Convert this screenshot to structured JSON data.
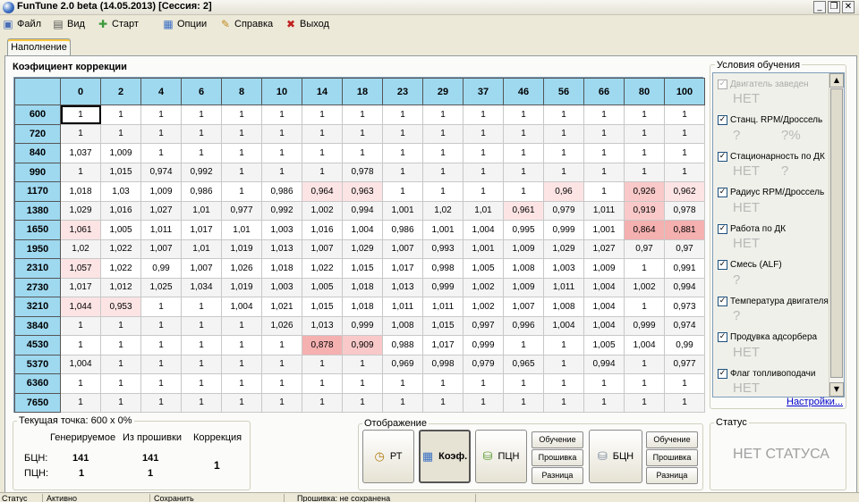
{
  "window": {
    "title": "FunTune 2.0 beta (14.05.2013) [Сессия: 2]",
    "controls": [
      "_",
      "❐",
      "✕"
    ]
  },
  "menu": [
    {
      "label": "Файл",
      "icon": "floppy-disk-icon"
    },
    {
      "label": "Вид",
      "icon": "table-icon"
    },
    {
      "label": "Старт",
      "icon": "start-icon"
    },
    {
      "label": "Опции",
      "icon": "options-icon"
    },
    {
      "label": "Справка",
      "icon": "help-icon"
    },
    {
      "label": "Выход",
      "icon": "exit-icon"
    }
  ],
  "tabs": [
    {
      "label": "Наполнение",
      "active": true
    }
  ],
  "coef": {
    "title": "Коэфициент коррекции",
    "columns": [
      "0",
      "2",
      "4",
      "6",
      "8",
      "10",
      "14",
      "18",
      "23",
      "29",
      "37",
      "46",
      "56",
      "66",
      "80",
      "100"
    ],
    "rows": [
      {
        "rpm": "600",
        "values": [
          "1",
          "1",
          "1",
          "1",
          "1",
          "1",
          "1",
          "1",
          "1",
          "1",
          "1",
          "1",
          "1",
          "1",
          "1",
          "1"
        ]
      },
      {
        "rpm": "720",
        "values": [
          "1",
          "1",
          "1",
          "1",
          "1",
          "1",
          "1",
          "1",
          "1",
          "1",
          "1",
          "1",
          "1",
          "1",
          "1",
          "1"
        ]
      },
      {
        "rpm": "840",
        "values": [
          "1,037",
          "1,009",
          "1",
          "1",
          "1",
          "1",
          "1",
          "1",
          "1",
          "1",
          "1",
          "1",
          "1",
          "1",
          "1",
          "1"
        ]
      },
      {
        "rpm": "990",
        "values": [
          "1",
          "1,015",
          "0,974",
          "0,992",
          "1",
          "1",
          "1",
          "0,978",
          "1",
          "1",
          "1",
          "1",
          "1",
          "1",
          "1",
          "1"
        ]
      },
      {
        "rpm": "1170",
        "values": [
          "1,018",
          "1,03",
          "1,009",
          "0,986",
          "1",
          "0,986",
          "0,964",
          "0,963",
          "1",
          "1",
          "1",
          "1",
          "0,96",
          "1",
          "0,926",
          "0,962"
        ]
      },
      {
        "rpm": "1380",
        "values": [
          "1,029",
          "1,016",
          "1,027",
          "1,01",
          "0,977",
          "0,992",
          "1,002",
          "0,994",
          "1,001",
          "1,02",
          "1,01",
          "0,961",
          "0,979",
          "1,011",
          "0,919",
          "0,978"
        ]
      },
      {
        "rpm": "1650",
        "values": [
          "1,061",
          "1,005",
          "1,011",
          "1,017",
          "1,01",
          "1,003",
          "1,016",
          "1,004",
          "0,986",
          "1,001",
          "1,004",
          "0,995",
          "0,999",
          "1,001",
          "0,864",
          "0,881"
        ]
      },
      {
        "rpm": "1950",
        "values": [
          "1,02",
          "1,022",
          "1,007",
          "1,01",
          "1,019",
          "1,013",
          "1,007",
          "1,029",
          "1,007",
          "0,993",
          "1,001",
          "1,009",
          "1,029",
          "1,027",
          "0,97",
          "0,97"
        ]
      },
      {
        "rpm": "2310",
        "values": [
          "1,057",
          "1,022",
          "0,99",
          "1,007",
          "1,026",
          "1,018",
          "1,022",
          "1,015",
          "1,017",
          "0,998",
          "1,005",
          "1,008",
          "1,003",
          "1,009",
          "1",
          "0,991"
        ]
      },
      {
        "rpm": "2730",
        "values": [
          "1,017",
          "1,012",
          "1,025",
          "1,034",
          "1,019",
          "1,003",
          "1,005",
          "1,018",
          "1,013",
          "0,999",
          "1,002",
          "1,009",
          "1,011",
          "1,004",
          "1,002",
          "0,994"
        ]
      },
      {
        "rpm": "3210",
        "values": [
          "1,044",
          "0,953",
          "1",
          "1",
          "1,004",
          "1,021",
          "1,015",
          "1,018",
          "1,011",
          "1,011",
          "1,002",
          "1,007",
          "1,008",
          "1,004",
          "1",
          "0,973"
        ]
      },
      {
        "rpm": "3840",
        "values": [
          "1",
          "1",
          "1",
          "1",
          "1",
          "1,026",
          "1,013",
          "0,999",
          "1,008",
          "1,015",
          "0,997",
          "0,996",
          "1,004",
          "1,004",
          "0,999",
          "0,974"
        ]
      },
      {
        "rpm": "4530",
        "values": [
          "1",
          "1",
          "1",
          "1",
          "1",
          "1",
          "0,878",
          "0,909",
          "0,988",
          "1,017",
          "0,999",
          "1",
          "1",
          "1,005",
          "1,004",
          "0,99"
        ]
      },
      {
        "rpm": "5370",
        "values": [
          "1,004",
          "1",
          "1",
          "1",
          "1",
          "1",
          "1",
          "1",
          "0,969",
          "0,998",
          "0,979",
          "0,965",
          "1",
          "0,994",
          "1",
          "0,977"
        ]
      },
      {
        "rpm": "6360",
        "values": [
          "1",
          "1",
          "1",
          "1",
          "1",
          "1",
          "1",
          "1",
          "1",
          "1",
          "1",
          "1",
          "1",
          "1",
          "1",
          "1"
        ]
      },
      {
        "rpm": "7650",
        "values": [
          "1",
          "1",
          "1",
          "1",
          "1",
          "1",
          "1",
          "1",
          "1",
          "1",
          "1",
          "1",
          "1",
          "1",
          "1",
          "1"
        ]
      }
    ],
    "highlight_colors": {
      "light": "#fde4e4",
      "medium": "#f9c9c9",
      "strong": "#f5b0b0"
    }
  },
  "conditions": {
    "title": "Условия обучения",
    "items": [
      {
        "label": "Двигатель заведен",
        "checked": true,
        "enabled": false,
        "values": [
          "НЕТ"
        ]
      },
      {
        "label": "Станц. RPM/Дроссель",
        "checked": true,
        "enabled": true,
        "values": [
          "?",
          "?%"
        ]
      },
      {
        "label": "Стационарность по ДК",
        "checked": true,
        "enabled": true,
        "values": [
          "НЕТ",
          "?"
        ]
      },
      {
        "label": "Радиус RPM/Дроссель",
        "checked": true,
        "enabled": true,
        "values": [
          "НЕТ"
        ]
      },
      {
        "label": "Работа по ДК",
        "checked": true,
        "enabled": true,
        "values": [
          "НЕТ"
        ]
      },
      {
        "label": "Смесь (ALF)",
        "checked": true,
        "enabled": true,
        "values": [
          "?"
        ]
      },
      {
        "label": "Температура двигателя",
        "checked": true,
        "enabled": true,
        "values": [
          "?"
        ]
      },
      {
        "label": "Продувка адсорбера",
        "checked": true,
        "enabled": true,
        "values": [
          "НЕТ"
        ]
      },
      {
        "label": "Флаг топливоподачи",
        "checked": true,
        "enabled": true,
        "values": [
          "НЕТ"
        ]
      }
    ],
    "settings_link": "Настройки..."
  },
  "current_point": {
    "title": "Текущая точка: 600 x 0%",
    "headers": [
      "Генерируемое",
      "Из прошивки",
      "Коррекция"
    ],
    "rows": [
      {
        "label": "БЦН:",
        "generated": "141",
        "firmware": "141"
      },
      {
        "label": "ПЦН:",
        "generated": "1",
        "firmware": "1"
      }
    ],
    "correction": "1"
  },
  "display": {
    "title": "Отображение",
    "buttons": {
      "rt": "РТ",
      "koef": "Коэф.",
      "pcn": "ПЦН",
      "bcn": "БЦН"
    },
    "small": {
      "learning": "Обучение",
      "firmware": "Прошивка",
      "difference": "Разница"
    }
  },
  "status": {
    "title": "Статус",
    "text": "НЕТ СТАТУСА"
  },
  "statusbar": [
    "Статус",
    "Активно",
    "Сохранить",
    "Прошивка: не сохранена"
  ]
}
